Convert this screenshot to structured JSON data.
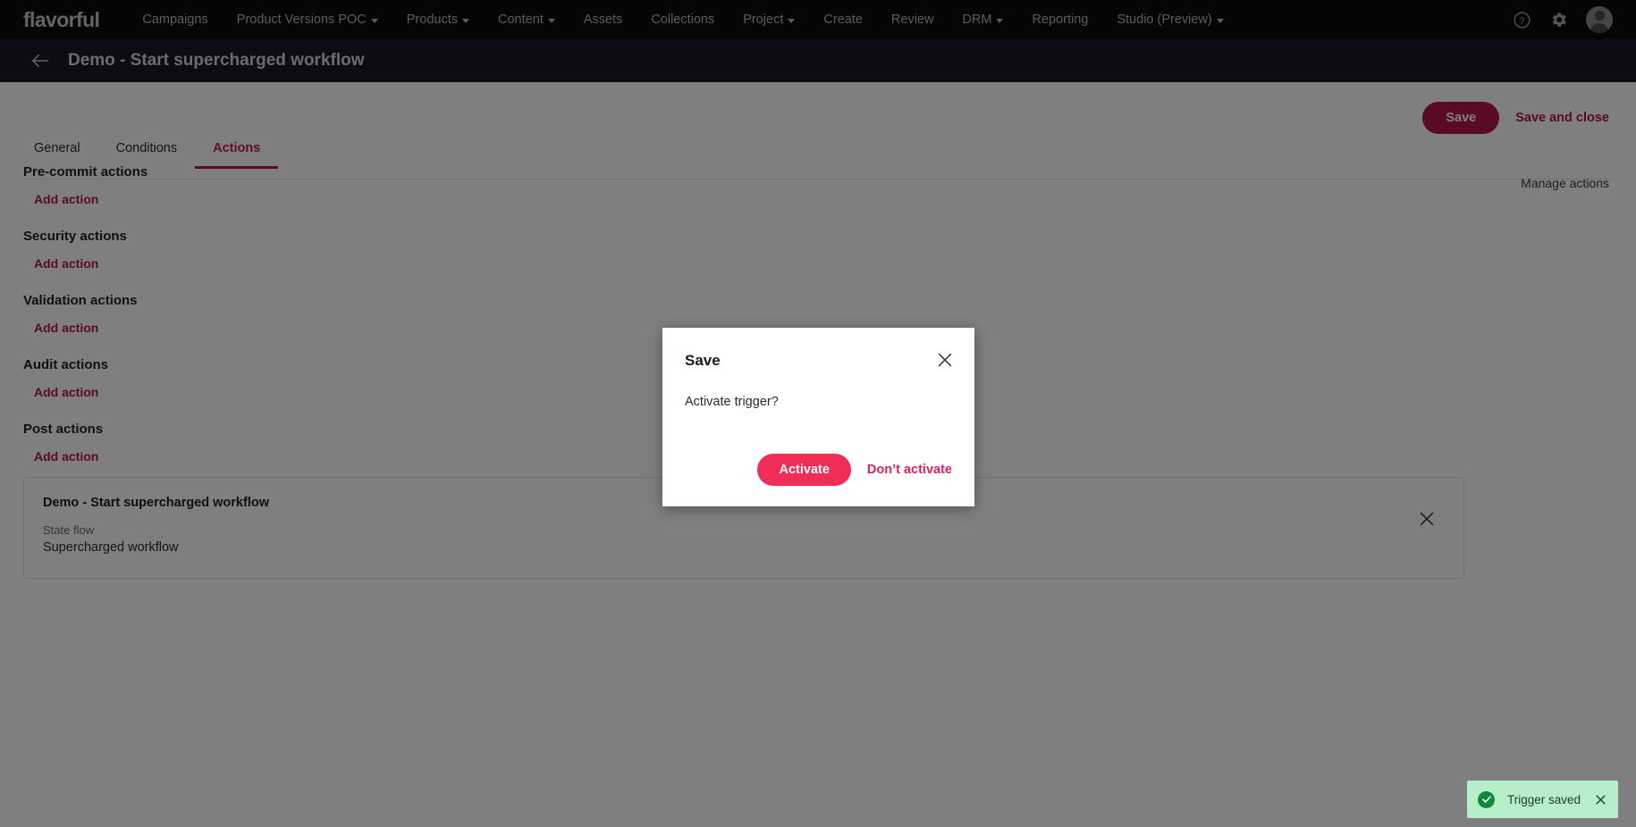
{
  "topnav": {
    "brand": "flavorful",
    "items": [
      {
        "label": "Campaigns",
        "caret": false
      },
      {
        "label": "Product Versions POC",
        "caret": true
      },
      {
        "label": "Products",
        "caret": true
      },
      {
        "label": "Content",
        "caret": true
      },
      {
        "label": "Assets",
        "caret": false
      },
      {
        "label": "Collections",
        "caret": false
      },
      {
        "label": "Project",
        "caret": true
      },
      {
        "label": "Create",
        "caret": false
      },
      {
        "label": "Review",
        "caret": false
      },
      {
        "label": "DRM",
        "caret": true
      },
      {
        "label": "Reporting",
        "caret": false
      },
      {
        "label": "Studio (Preview)",
        "caret": true
      }
    ],
    "right_icons": [
      "help-icon",
      "gear-icon",
      "avatar"
    ]
  },
  "titlebar": {
    "back_icon": "arrow-left-icon",
    "title": "Demo - Start supercharged workflow"
  },
  "toolbar": {
    "save_label": "Save",
    "save_and_close_label": "Save and close"
  },
  "tabs": [
    {
      "label": "General",
      "active": false
    },
    {
      "label": "Conditions",
      "active": false
    },
    {
      "label": "Actions",
      "active": true
    }
  ],
  "manage_actions_label": "Manage actions",
  "sections": [
    {
      "title": "Pre-commit actions",
      "add_label": "Add action"
    },
    {
      "title": "Security actions",
      "add_label": "Add action"
    },
    {
      "title": "Validation actions",
      "add_label": "Add action"
    },
    {
      "title": "Audit actions",
      "add_label": "Add action"
    },
    {
      "title": "Post actions",
      "add_label": "Add action"
    }
  ],
  "flow_card": {
    "title": "Demo - Start supercharged workflow",
    "field_label": "State flow",
    "field_value": "Supercharged workflow",
    "close_icon": "close-icon"
  },
  "modal": {
    "title": "Save",
    "body": "Activate trigger?",
    "activate_label": "Activate",
    "dont_activate_label": "Don’t activate",
    "close_icon": "close-icon"
  },
  "toast": {
    "message": "Trigger saved",
    "status_icon": "check-circle-icon",
    "close_icon": "close-icon"
  },
  "colors": {
    "topnav_bg": "#0b0b0c",
    "titlebar_bg": "#161b24",
    "brand_pink": "#b2164b",
    "accent_pink": "#ef2d56",
    "toast_bg": "#b6eec9",
    "toast_icon": "#0f8a3e"
  }
}
